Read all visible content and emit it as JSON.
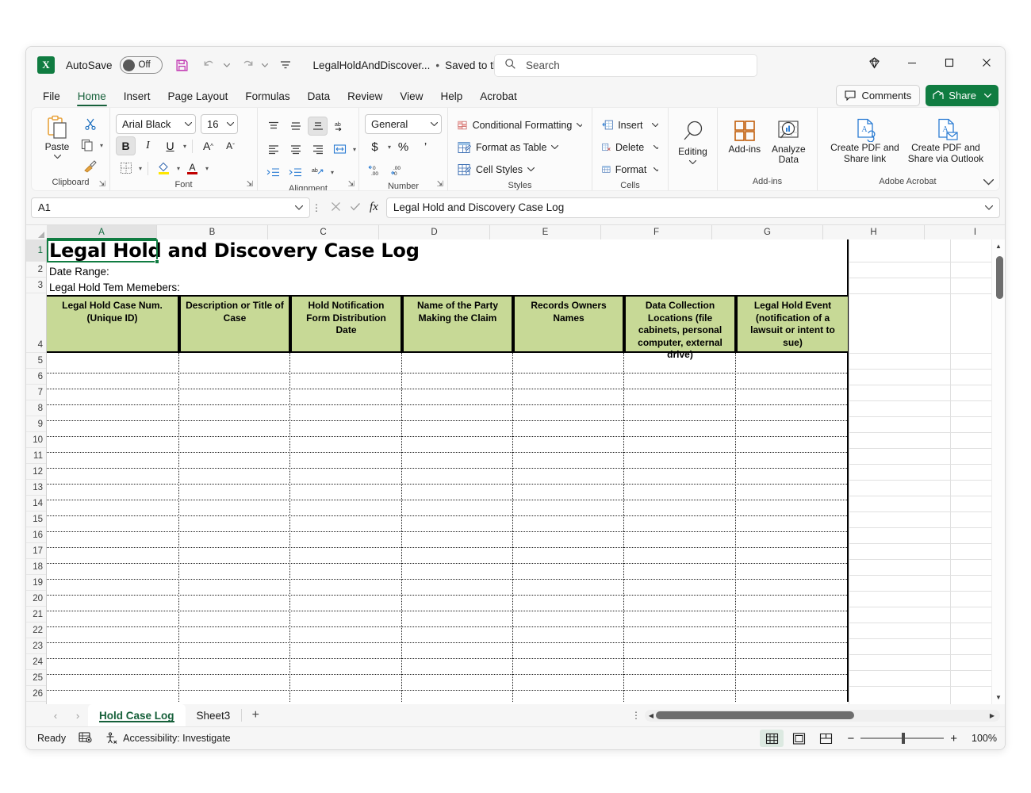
{
  "titlebar": {
    "app_icon": "excel-icon",
    "autosave_label": "AutoSave",
    "autosave_state": "Off",
    "save_icon": "save-icon",
    "undo_icon": "undo-icon",
    "redo_icon": "redo-icon",
    "customize_qat_icon": "customize-quick-access-toolbar-icon",
    "document_name": "LegalHoldAndDiscover...",
    "save_status": "Saved to this PC",
    "save_status_sep": "•",
    "search_placeholder": "Search",
    "search_icon": "search-icon",
    "diamond_icon": "diamond-icon",
    "minimize": "—",
    "maximize": "□",
    "close": "✕"
  },
  "tabs": {
    "items": [
      "File",
      "Home",
      "Insert",
      "Page Layout",
      "Formulas",
      "Data",
      "Review",
      "View",
      "Help",
      "Acrobat"
    ],
    "active": "Home",
    "comments_label": "Comments",
    "share_label": "Share"
  },
  "ribbon": {
    "groups": [
      {
        "name": "Clipboard",
        "label": "Clipboard"
      },
      {
        "name": "Font",
        "label": "Font"
      },
      {
        "name": "Alignment",
        "label": "Alignment"
      },
      {
        "name": "Number",
        "label": "Number"
      },
      {
        "name": "Styles",
        "label": "Styles"
      },
      {
        "name": "Cells",
        "label": "Cells"
      },
      {
        "name": "Editing",
        "label": ""
      },
      {
        "name": "Add-ins",
        "label": "Add-ins"
      },
      {
        "name": "Adobe Acrobat",
        "label": "Adobe Acrobat"
      }
    ],
    "clipboard": {
      "paste_label": "Paste",
      "cut_icon": "scissors-icon",
      "copy_icon": "copy-icon",
      "format_painter_icon": "format-painter-icon"
    },
    "font": {
      "font_name": "Arial Black",
      "font_size": "16",
      "bold": "B",
      "italic": "I",
      "underline": "U",
      "grow_font": "A",
      "shrink_font": "A",
      "borders_icon": "borders-icon",
      "fill_color_icon": "fill-color-icon",
      "font_color_icon": "font-color-icon"
    },
    "alignment": {
      "top_align_icon": "align-top-icon",
      "middle_align_icon": "align-middle-icon",
      "bottom_align_icon": "align-bottom-icon",
      "orientation_icon": "orientation-icon",
      "align_left_icon": "align-left-icon",
      "align_center_icon": "align-center-icon",
      "align_right_icon": "align-right-icon",
      "wrap_text_icon": "wrap-text-icon",
      "decrease_indent_icon": "decrease-indent-icon",
      "increase_indent_icon": "increase-indent-icon",
      "merge_icon": "merge-and-center-icon"
    },
    "number": {
      "format": "General",
      "accounting_icon": "currency-icon",
      "percent_icon": "percent-style-icon",
      "comma_icon": "comma-style-icon",
      "increase_decimal_icon": "increase-decimal-icon",
      "decrease_decimal_icon": "decrease-decimal-icon"
    },
    "styles": {
      "conditional_formatting": "Conditional Formatting",
      "format_as_table": "Format as Table",
      "cell_styles": "Cell Styles"
    },
    "cells": {
      "insert": "Insert",
      "delete": "Delete",
      "format": "Format"
    },
    "editing": {
      "label": "Editing"
    },
    "addins": {
      "label": "Add-ins",
      "analyze_data": "Analyze Data"
    },
    "acrobat": {
      "create_pdf_share_link": "Create PDF and Share link",
      "create_pdf_outlook": "Create PDF and Share via Outlook"
    },
    "collapse_icon": "collapse-ribbon-icon"
  },
  "formula_bar": {
    "name_box": "A1",
    "cancel_icon": "cancel-icon",
    "enter_icon": "enter-icon",
    "function_icon": "fx",
    "formula_value": "Legal Hold and Discovery Case Log",
    "expand_icon": "expand-formula-bar-icon"
  },
  "grid": {
    "columns": [
      "A",
      "B",
      "C",
      "D",
      "E",
      "F",
      "G",
      "H",
      "I"
    ],
    "selected_column": "A",
    "rows": [
      1,
      2,
      3,
      4,
      5,
      6,
      7,
      8,
      9,
      10,
      11,
      12,
      13,
      14,
      15,
      16,
      17,
      18,
      19,
      20,
      21,
      22,
      23,
      24,
      25,
      26
    ],
    "selected_row": 1,
    "selected_cell": "A1",
    "title_cell": "Legal Hold and Discovery Case Log",
    "label_cells": [
      {
        "ref": "A2",
        "text": "Date Range:"
      },
      {
        "ref": "A3",
        "text": "Legal Hold Tem Memebers:"
      }
    ],
    "header_fill": "#c7d996",
    "table_headers": [
      "Legal Hold Case Num. (Unique ID)",
      "Description or Title of Case",
      "Hold Notification Form Distribution Date",
      "Name of the Party Making the Claim",
      "Records Owners Names",
      "Data Collection Locations (file cabinets, personal computer, external drive)",
      "Legal Hold Event (notification of a lawsuit or intent to sue)"
    ]
  },
  "sheets": {
    "prev_icon": "previous-sheet-icon",
    "next_icon": "next-sheet-icon",
    "tabs": [
      "Hold Case Log",
      "Sheet3"
    ],
    "active": "Hold Case Log",
    "add_label": "+"
  },
  "status": {
    "mode": "Ready",
    "macro_icon": "record-macro-icon",
    "accessibility_icon": "accessibility-icon",
    "accessibility": "Accessibility: Investigate",
    "view_normal_icon": "normal-view-icon",
    "view_pagelayout_icon": "page-layout-view-icon",
    "view_pagebreak_icon": "page-break-preview-icon",
    "zoom_out": "−",
    "zoom_in": "+",
    "zoom_level": "100%"
  }
}
